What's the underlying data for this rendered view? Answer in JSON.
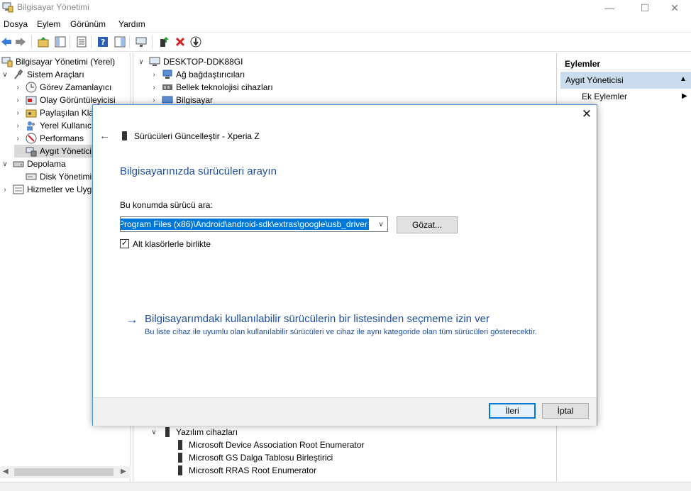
{
  "window": {
    "title": "Bilgisayar Yönetimi",
    "minimize": "—",
    "maximize": "☐",
    "close": "✕"
  },
  "menu": [
    "Dosya",
    "Eylem",
    "Görünüm",
    "Yardım"
  ],
  "left_tree": {
    "root": "Bilgisayar Yönetimi (Yerel)",
    "system_tools": "Sistem Araçları",
    "task_scheduler": "Görev Zamanlayıcı",
    "event_viewer": "Olay Görüntüleyicisi",
    "shared_folders": "Paylaşılan Kla",
    "local_users": "Yerel Kullanıcı",
    "performance": "Performans",
    "device_manager": "Aygıt Yönetici",
    "storage": "Depolama",
    "disk_management": "Disk Yönetimi",
    "services": "Hizmetler ve Uyg"
  },
  "center_tree": {
    "computer": "DESKTOP-DDK88GI",
    "items": [
      "Ağ bağdaştırıcıları",
      "Bellek teknolojisi cihazları",
      "Bilgisayar"
    ],
    "software_devices": "Yazılım cihazları",
    "software_items": [
      "Microsoft Device Association Root Enumerator",
      "Microsoft GS Dalga Tablosu Birleştirici",
      "Microsoft RRAS Root Enumerator"
    ]
  },
  "actions": {
    "header": "Eylemler",
    "section": "Aygıt Yöneticisi",
    "more": "Ek Eylemler"
  },
  "dialog": {
    "title": "Sürücüleri Güncelleştir - Xperia Z",
    "heading": "Bilgisayarınızda sürücüleri arayın",
    "path_label": "Bu konumda sürücü ara:",
    "path_value": "Program Files (x86)\\Android\\android-sdk\\extras\\google\\usb_driver",
    "browse": "Gözat...",
    "include_subfolders": "Alt klasörlerle birlikte",
    "include_subfolders_checked": true,
    "pick_link": "Bilgisayarımdaki kullanılabilir sürücülerin bir listesinden seçmeme izin ver",
    "pick_desc": "Bu liste cihaz ile uyumlu olan kullanılabilir sürücüleri ve cihaz ile aynı kategoride olan tüm sürücüleri gösterecektir.",
    "next": "İleri",
    "cancel": "İptal"
  }
}
